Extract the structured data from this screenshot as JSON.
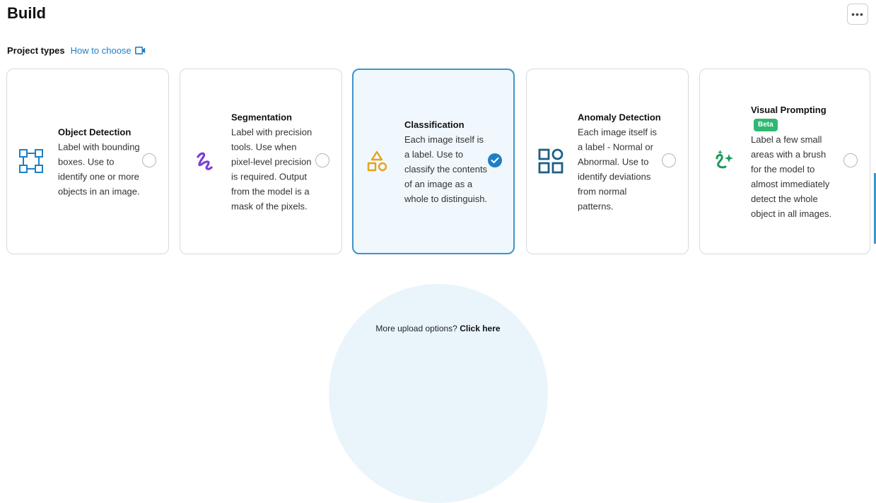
{
  "page": {
    "title": "Build"
  },
  "toolbar": {
    "more_label": "•••"
  },
  "section": {
    "label": "Project types",
    "help_link": "How to choose"
  },
  "cards": [
    {
      "title": "Object Detection",
      "description": "Label with bounding boxes. Use to identify one or more objects in an image.",
      "icon": "bounding-box-icon",
      "selected": false
    },
    {
      "title": "Segmentation",
      "description": "Label with precision tools. Use when pixel-level precision is required. Output from the model is a mask of the pixels.",
      "icon": "brush-stroke-icon",
      "selected": false
    },
    {
      "title": "Classification",
      "description": "Each image itself is a label. Use to classify the contents of an image as a whole to distinguish.",
      "icon": "shapes-icon",
      "selected": true
    },
    {
      "title": "Anomaly Detection",
      "description": "Each image itself is a label - Normal or Abnormal. Use to identify deviations from normal patterns.",
      "icon": "grid-shapes-icon",
      "selected": false
    },
    {
      "title": "Visual Prompting",
      "badge": "Beta",
      "description": "Label a few small areas with a brush for the model to almost immediately detect the whole object in all images.",
      "icon": "sparkle-prompt-icon",
      "selected": false
    }
  ],
  "upload": {
    "prompt": "More upload options?",
    "link": "Click here"
  },
  "colors": {
    "accent": "#1f7fc4",
    "selected_border": "#3e95c7",
    "selected_bg": "#f0f8fd",
    "object_detection_icon": "#1f7fc4",
    "segmentation_icon": "#7a3fd6",
    "classification_icon": "#e8a317",
    "anomaly_icon": "#1d5f86",
    "visual_prompting_icon": "#1b9a5a",
    "beta_badge": "#2fb872"
  }
}
